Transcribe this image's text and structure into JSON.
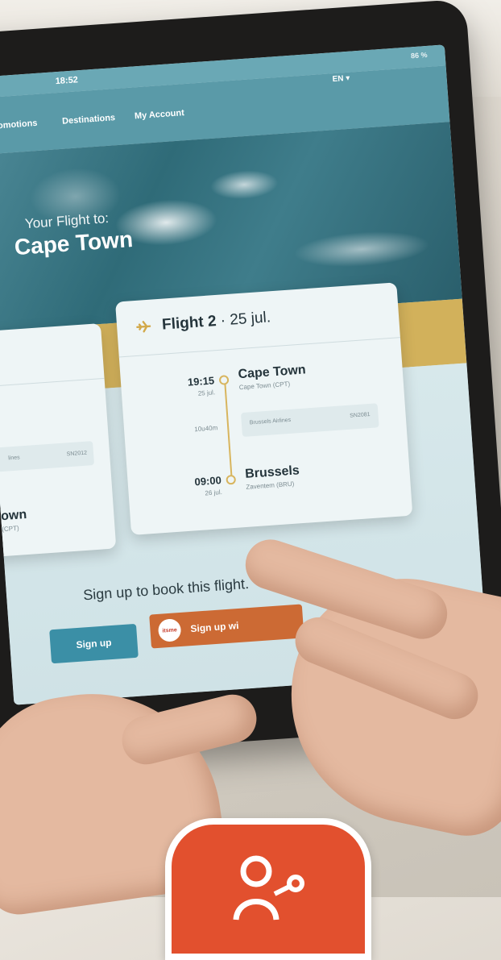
{
  "status_bar": {
    "time": "18:52",
    "battery": "86 %"
  },
  "nav": {
    "items": [
      {
        "label": "Promotions"
      },
      {
        "label": "Destinations"
      },
      {
        "label": "My Account"
      }
    ],
    "language": "EN ▾"
  },
  "hero": {
    "subtitle": "Your Flight to:",
    "title": "Cape Town"
  },
  "flight_card": {
    "title_bold": "Flight 2",
    "title_rest": " · 25 jul.",
    "departure": {
      "time": "19:15",
      "date": "25 jul.",
      "city": "Cape Town",
      "airport": "Cape Town (CPT)"
    },
    "duration": "10u40m",
    "airline": {
      "name": "Brussels Airlines",
      "flight_number": "SN2081"
    },
    "arrival": {
      "time": "09:00",
      "date": "26 jul.",
      "city": "Brussels",
      "airport": "Zaventem (BRU)"
    }
  },
  "left_card": {
    "paren": ")",
    "airline_fragment": "lines",
    "flight_number": "SN2012",
    "city_fragment": "own",
    "airport_fragment": "(CPT)"
  },
  "signup": {
    "prompt": "Sign up to book this flight.",
    "signup_button": "Sign up",
    "partner_button": "Sign up wi",
    "partner_badge": "itsme"
  },
  "colors": {
    "accent_teal": "#3b8fa6",
    "accent_orange": "#cc6a34",
    "gold": "#d2b15b",
    "brand_red": "#e2502e"
  }
}
